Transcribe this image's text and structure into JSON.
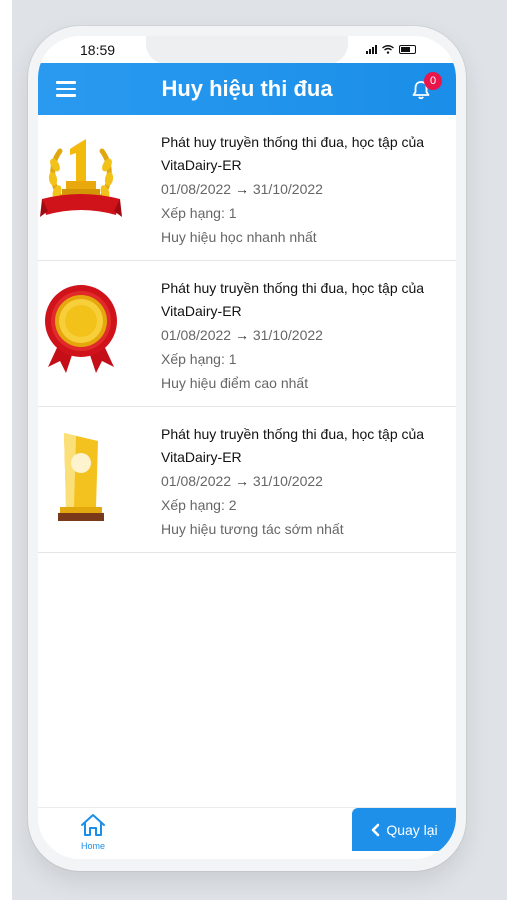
{
  "status": {
    "time": "18:59"
  },
  "header": {
    "title": "Huy hiệu thi đua",
    "notification_count": "0"
  },
  "badges": [
    {
      "name": "Phát huy truyền thống thi đua, học tập của VitaDairy-ER",
      "start": "01/08/2022",
      "end": "31/10/2022",
      "rank": "Xếp hạng: 1",
      "type": "Huy hiệu học nhanh nhất",
      "icon": "laurel-rank-1-trophy-icon"
    },
    {
      "name": "Phát huy truyền thống thi đua, học tập của VitaDairy-ER",
      "start": "01/08/2022",
      "end": "31/10/2022",
      "rank": "Xếp hạng: 1",
      "type": "Huy hiệu điểm cao nhất",
      "icon": "gold-medal-rosette-icon"
    },
    {
      "name": "Phát huy truyền thống thi đua, học tập của VitaDairy-ER",
      "start": "01/08/2022",
      "end": "31/10/2022",
      "rank": "Xếp hạng: 2",
      "type": "Huy hiệu tương tác sớm nhất",
      "icon": "crystal-trophy-icon"
    }
  ],
  "bottom_bar": {
    "home_label": "Home",
    "back_label": "Quay lại"
  },
  "colors": {
    "primary": "#1a8ee8",
    "badge": "#e8164a",
    "ribbon": "#d0121b",
    "gold": "#f2b90f"
  }
}
